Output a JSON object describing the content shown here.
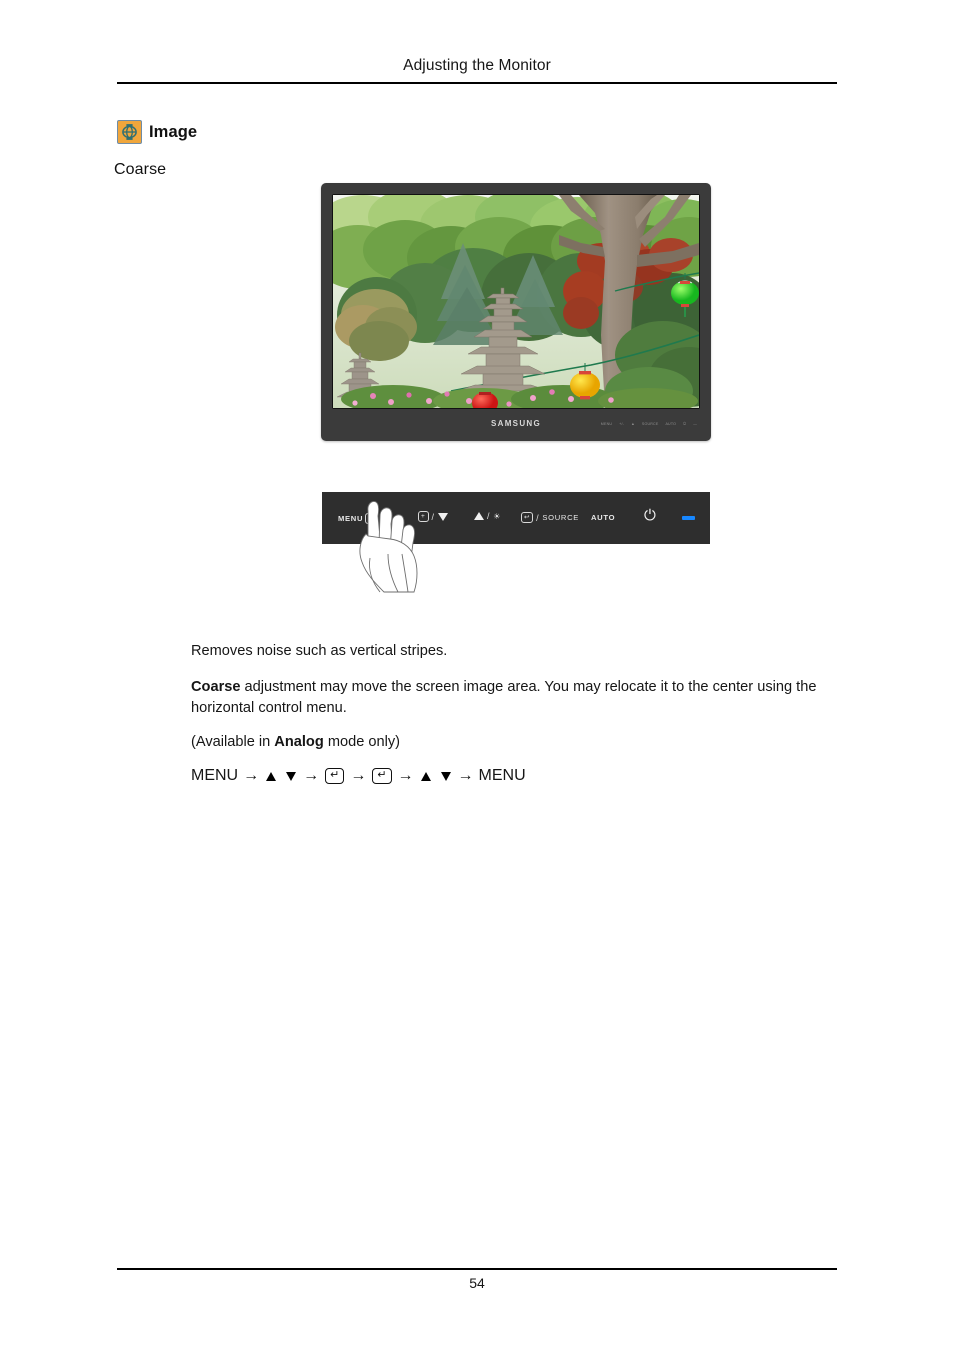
{
  "header": {
    "title": "Adjusting the Monitor"
  },
  "section": {
    "icon_name": "image-settings-icon",
    "title": "Image",
    "subtitle": "Coarse"
  },
  "monitor_figure": {
    "brand": "SAMSUNG",
    "screen_description": "Garden scene with stone pagodas, green trees, red and yellow paper lanterns",
    "bezel_keys": [
      "MENU",
      "+/-",
      "▲",
      "SOURCE",
      "AUTO",
      "⏻",
      "—"
    ]
  },
  "control_panel": {
    "menu_label": "MENU",
    "menu_key_glyph": "⌸",
    "enter_key_label": "+",
    "enter_down_separator": "/",
    "up_label": "▲",
    "brightness_glyph": "☀",
    "source_key_label": "↩",
    "source_label": "SOURCE",
    "auto_label": "AUTO",
    "power_glyph": "⏻",
    "led_name": "power-led",
    "led_color": "#1787ff",
    "panel_color": "#2e2e2e"
  },
  "body": {
    "paragraph_1": "Removes noise such as vertical stripes.",
    "paragraph_2_bold": "Coarse",
    "paragraph_2_rest": " adjustment may move the screen image area. You may relocate it to the center using the horizontal control menu.",
    "paragraph_3_pre": "(Available in ",
    "paragraph_3_bold": "Analog",
    "paragraph_3_post": " mode only)",
    "nav_start": "MENU",
    "nav_end": "MENU",
    "nav_arrow": "→",
    "nav_enter_glyph": "↵"
  },
  "footer": {
    "page_number": "54"
  }
}
